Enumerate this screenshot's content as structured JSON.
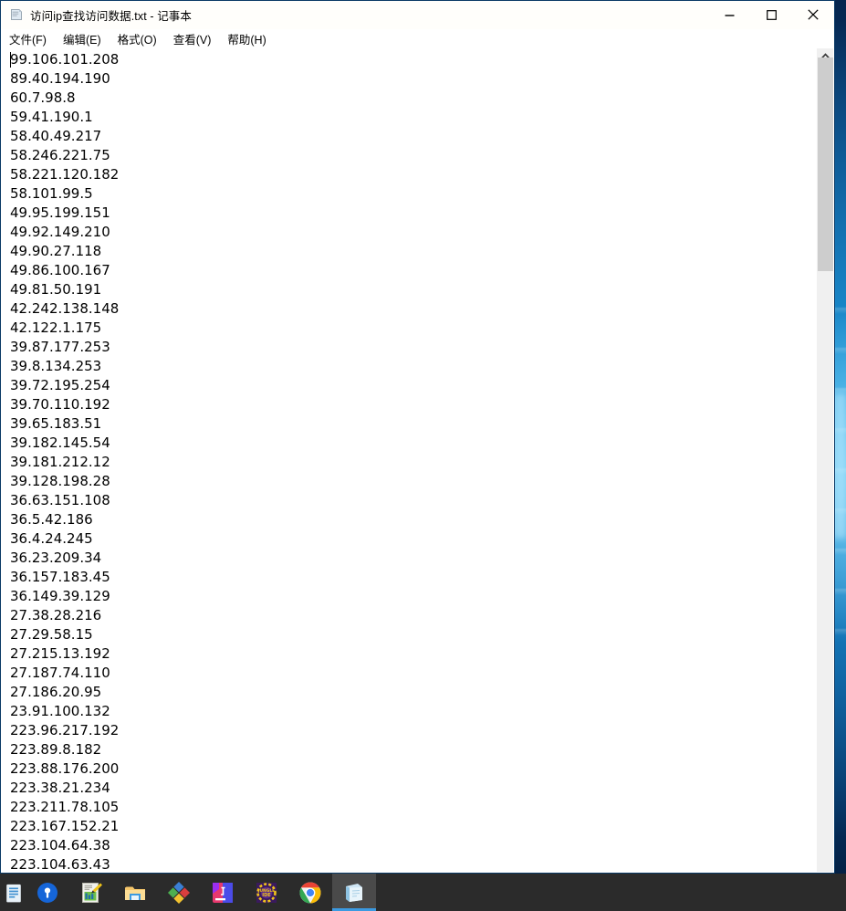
{
  "window": {
    "title": "访问ip查找访问数据.txt - 记事本",
    "icon": "notepad-icon",
    "controls": {
      "minimize_label": "最小化",
      "maximize_label": "最大化",
      "close_label": "关闭"
    }
  },
  "menu": {
    "items": [
      {
        "label": "文件(F)"
      },
      {
        "label": "编辑(E)"
      },
      {
        "label": "格式(O)"
      },
      {
        "label": "查看(V)"
      },
      {
        "label": "帮助(H)"
      }
    ]
  },
  "editor": {
    "lines": [
      "99.106.101.208",
      "89.40.194.190",
      "60.7.98.8",
      "59.41.190.1",
      "58.40.49.217",
      "58.246.221.75",
      "58.221.120.182",
      "58.101.99.5",
      "49.95.199.151",
      "49.92.149.210",
      "49.90.27.118",
      "49.86.100.167",
      "49.81.50.191",
      "42.242.138.148",
      "42.122.1.175",
      "39.87.177.253",
      "39.8.134.253",
      "39.72.195.254",
      "39.70.110.192",
      "39.65.183.51",
      "39.182.145.54",
      "39.181.212.12",
      "39.128.198.28",
      "36.63.151.108",
      "36.5.42.186",
      "36.4.24.245",
      "36.23.209.34",
      "36.157.183.45",
      "36.149.39.129",
      "27.38.28.216",
      "27.29.58.15",
      "27.215.13.192",
      "27.187.74.110",
      "27.186.20.95",
      "23.91.100.132",
      "223.96.217.192",
      "223.89.8.182",
      "223.88.176.200",
      "223.38.21.234",
      "223.211.78.105",
      "223.167.152.21",
      "223.104.64.38",
      "223.104.63.43"
    ]
  },
  "scrollbar": {
    "up_arrow": "chevron-up-icon"
  },
  "taskbar": {
    "items": [
      {
        "name": "start-button",
        "icon": "windows-start-icon",
        "active": false
      },
      {
        "name": "cortana-search",
        "icon": "search-circle-icon",
        "active": false
      },
      {
        "name": "image-editor",
        "icon": "picture-editor-icon",
        "active": false
      },
      {
        "name": "file-explorer",
        "icon": "folder-icon",
        "active": false
      },
      {
        "name": "diamond-app",
        "icon": "diamond-icon",
        "active": false
      },
      {
        "name": "intellij-idea",
        "icon": "intellij-icon",
        "active": false
      },
      {
        "name": "jungle-ide",
        "icon": "jungle-ide-icon",
        "active": false
      },
      {
        "name": "google-chrome",
        "icon": "chrome-icon",
        "active": false
      },
      {
        "name": "notepad",
        "icon": "notepad-icon",
        "active": true
      }
    ]
  },
  "colors": {
    "accent": "#3b9ae1",
    "window_border": "#0a3a66",
    "taskbar_bg": "#2b2b2b",
    "scroll_thumb": "#cdcdcd"
  }
}
